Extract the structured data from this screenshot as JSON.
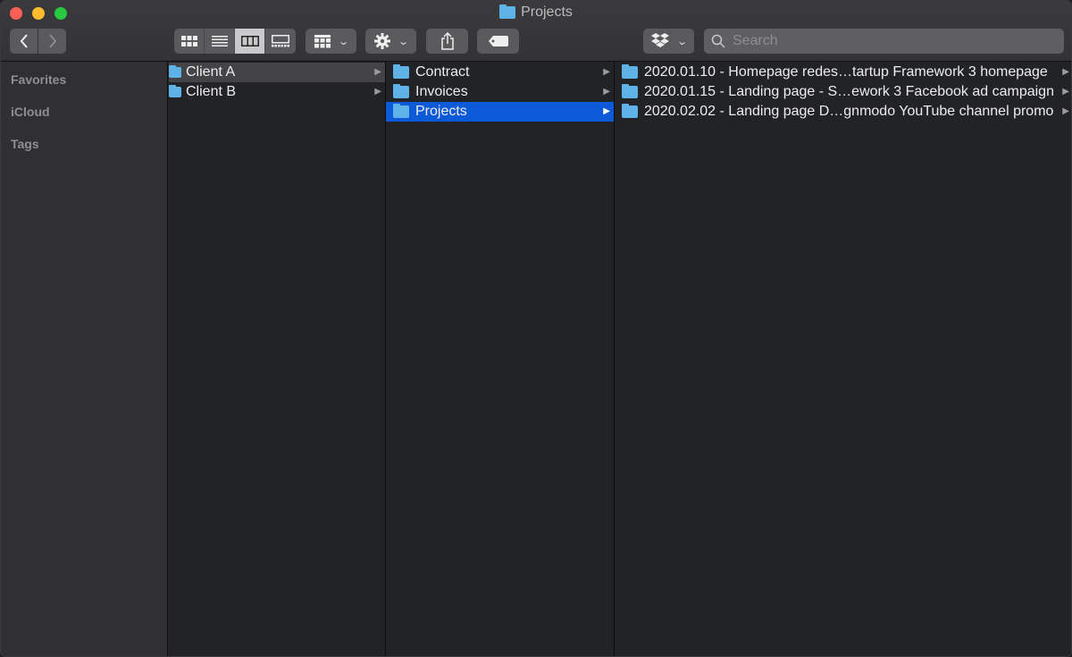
{
  "window": {
    "title": "Projects"
  },
  "toolbar": {
    "back_icon": "chevron-left",
    "forward_icon": "chevron-right",
    "view_modes": [
      "icon-view",
      "list-view",
      "column-view",
      "gallery-view"
    ],
    "active_view": "column-view",
    "group_icon": "grid-group",
    "action_icon": "gear",
    "share_icon": "share",
    "tag_icon": "tag",
    "dropbox_icon": "dropbox",
    "search_placeholder": "Search"
  },
  "sidebar": {
    "sections": [
      {
        "label": "Favorites"
      },
      {
        "label": "iCloud"
      },
      {
        "label": "Tags"
      }
    ]
  },
  "columns": [
    {
      "items": [
        {
          "name": "Client A",
          "selected": "inactive"
        },
        {
          "name": "Client B",
          "selected": "none"
        }
      ]
    },
    {
      "items": [
        {
          "name": "Contract",
          "selected": "none"
        },
        {
          "name": "Invoices",
          "selected": "none"
        },
        {
          "name": "Projects",
          "selected": "active"
        }
      ]
    },
    {
      "items": [
        {
          "name": "2020.01.10 - Homepage redes…tartup Framework  3 homepage",
          "selected": "none"
        },
        {
          "name": "2020.01.15 - Landing page - S…ework 3 Facebook ad campaign",
          "selected": "none"
        },
        {
          "name": "2020.02.02 - Landing page  D…gnmodo YouTube channel promo",
          "selected": "none"
        }
      ]
    }
  ],
  "colors": {
    "selection_active": "#0d5ad8",
    "folder": "#5eb2e6"
  }
}
